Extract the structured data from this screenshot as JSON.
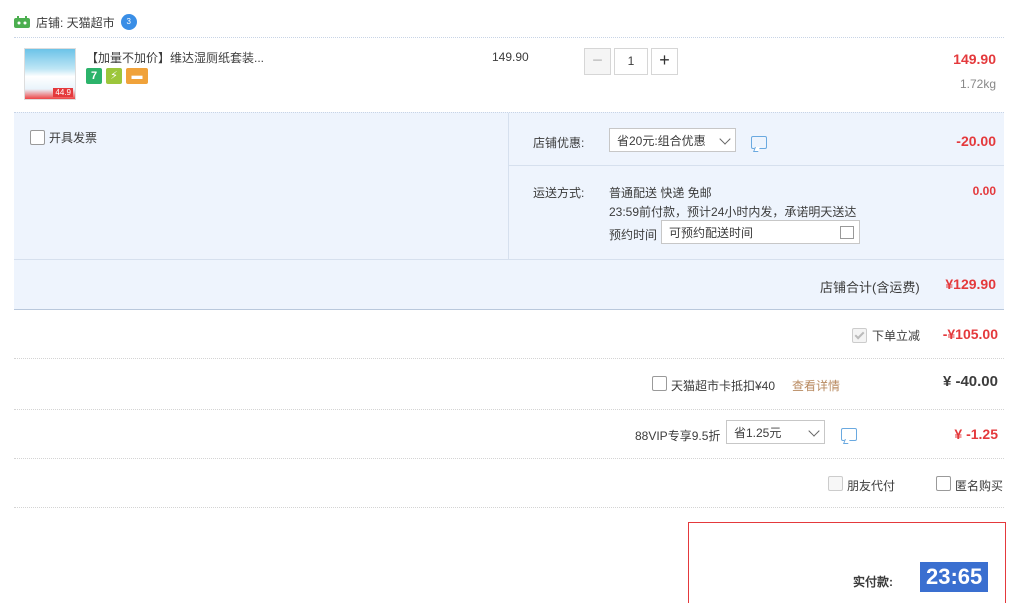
{
  "shop": {
    "label": "店铺: 天猫超市",
    "ww_badge": "3"
  },
  "item": {
    "title": "【加量不加价】维达湿厕纸套装...",
    "thumb_price": "44.9",
    "badges": [
      {
        "text": "7",
        "color": "#2cb36b"
      },
      {
        "text": "⚡",
        "color": "#9cc63b"
      },
      {
        "text": "▬",
        "color": "#f0a23a"
      }
    ],
    "unit_price": "149.90",
    "quantity": "1",
    "minus": "−",
    "plus": "+",
    "subtotal": "149.90",
    "weight": "1.72kg"
  },
  "order": {
    "invoice_label": "开具发票",
    "shop_discount_label": "店铺优惠:",
    "shop_discount_select": "省20元:组合优惠",
    "shop_discount_value": "-20.00",
    "shipping_label": "运送方式:",
    "shipping_method": "普通配送 快递 免邮",
    "shipping_note": "23:59前付款，预计24小时内发，承诺明天送达",
    "shipping_value": "0.00",
    "reserve_label": "预约时间",
    "reserve_placeholder": "可预约配送时间",
    "shop_total_label": "店铺合计(含运费)",
    "shop_total_value": "¥129.90"
  },
  "discounts": {
    "instant_label": "下单立减",
    "instant_value": "-¥105.00",
    "card_label": "天猫超市卡抵扣¥40",
    "card_link": "查看详情",
    "card_value": "¥ -40.00",
    "vip_label": "88VIP专享9.5折",
    "vip_select": "省1.25元",
    "vip_value": "¥ -1.25",
    "friend_pay": "朋友代付",
    "anonymous": "匿名购买"
  },
  "pay": {
    "label": "实付款:",
    "timer": "23:65"
  }
}
